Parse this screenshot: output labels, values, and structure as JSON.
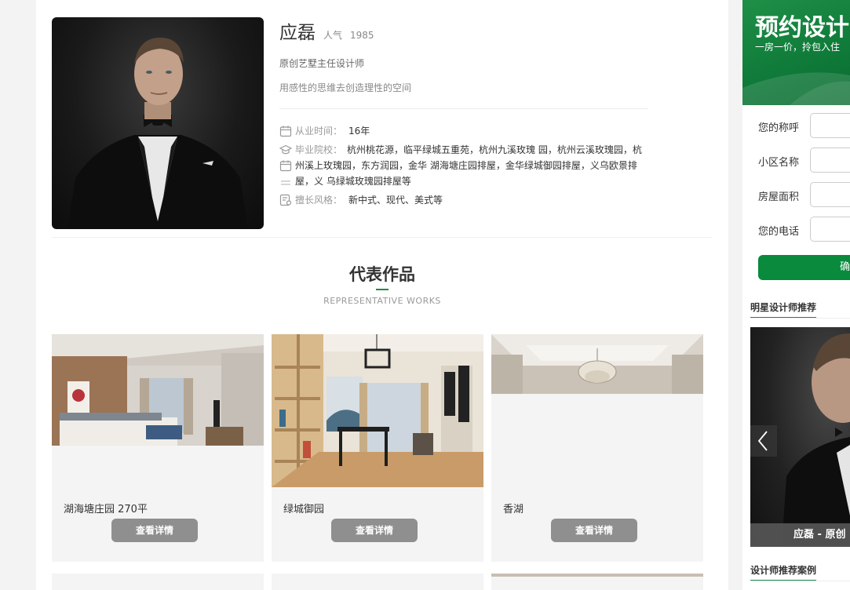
{
  "designer": {
    "name": "应磊",
    "popularity_label": "人气",
    "popularity_value": "1985",
    "title": "原创艺墅主任设计师",
    "slogan": "用感性的思维去创造理性的空间",
    "experience_label": "从业时间：",
    "experience_value": "16年",
    "school_label": "毕业院校：",
    "school_value": "杭州桃花源，临平绿城五重苑，杭州九溪玫瑰 园，杭州云溪玫瑰园，杭州溪上玫瑰园，东方润园，金华 湖海塘庄园排屋，金华绿城御园排屋，义乌欧景排屋，义 乌绿城玫瑰园排屋等",
    "style_label": "擅长风格：",
    "style_value": "新中式、现代、美式等"
  },
  "works": {
    "title": "代表作品",
    "subtitle": "REPRESENTATIVE  WORKS",
    "items": [
      {
        "caption": "湖海塘庄园 270平",
        "button": "查看详情"
      },
      {
        "caption": "绿城御园",
        "button": "查看详情"
      },
      {
        "caption": "香湖",
        "button": "查看详情"
      }
    ]
  },
  "sidebar": {
    "banner_title": "预约设计",
    "banner_sub": "一房一价，拎包入住",
    "form": [
      {
        "label": "您的称呼",
        "value": ""
      },
      {
        "label": "小区名称",
        "value": ""
      },
      {
        "label": "房屋面积",
        "value": ""
      },
      {
        "label": "您的电话",
        "value": ""
      }
    ],
    "submit": "确",
    "star_title": "明星设计师推荐",
    "slide_caption": "应磊 - 原创",
    "case_title": "设计师推荐案例"
  },
  "colors": {
    "accent": "#1c8a47",
    "button_gray": "#8f8f8f",
    "banner_green": "#0f7a39"
  }
}
